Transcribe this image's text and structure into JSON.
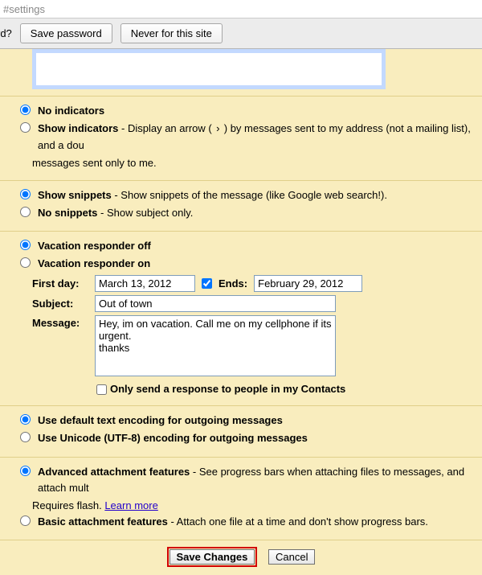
{
  "url_fragment": "#settings",
  "pw_bar": {
    "prompt_suffix": "rd?",
    "save": "Save password",
    "never": "Never for this site"
  },
  "indicators": {
    "no_label": "No indicators",
    "show_label": "Show indicators",
    "show_desc_a": " - Display an arrow ( ",
    "arrow": "›",
    "show_desc_b": " ) by messages sent to my address (not a mailing list), and a dou",
    "line2": "messages sent only to me.",
    "selected": "no"
  },
  "snippets": {
    "show_label": "Show snippets",
    "show_desc": " - Show snippets of the message (like Google web search!).",
    "no_label": "No snippets",
    "no_desc": " - Show subject only.",
    "selected": "show"
  },
  "vacation": {
    "off_label": "Vacation responder off",
    "on_label": "Vacation responder on",
    "selected": "off",
    "first_day_label": "First day:",
    "first_day_value": "March 13, 2012",
    "ends_checked": true,
    "ends_label": "Ends:",
    "ends_value": "February 29, 2012",
    "subject_label": "Subject:",
    "subject_value": "Out of town",
    "message_label": "Message:",
    "message_value": "Hey, im on vacation. Call me on my cellphone if its urgent.\nthanks",
    "contacts_only_label": "Only send a response to people in my Contacts",
    "contacts_only_checked": false
  },
  "encoding": {
    "default_label": "Use default text encoding for outgoing messages",
    "unicode_label": "Use Unicode (UTF-8) encoding for outgoing messages",
    "selected": "default"
  },
  "attachments": {
    "adv_label": "Advanced attachment features",
    "adv_desc": " - See progress bars when attaching files to messages, and attach mult",
    "adv_line2a": "Requires flash. ",
    "learn_more": "Learn more",
    "basic_label": "Basic attachment features",
    "basic_desc": " - Attach one file at a time and don't show progress bars.",
    "selected": "adv"
  },
  "footer": {
    "save": "Save Changes",
    "cancel": "Cancel"
  }
}
